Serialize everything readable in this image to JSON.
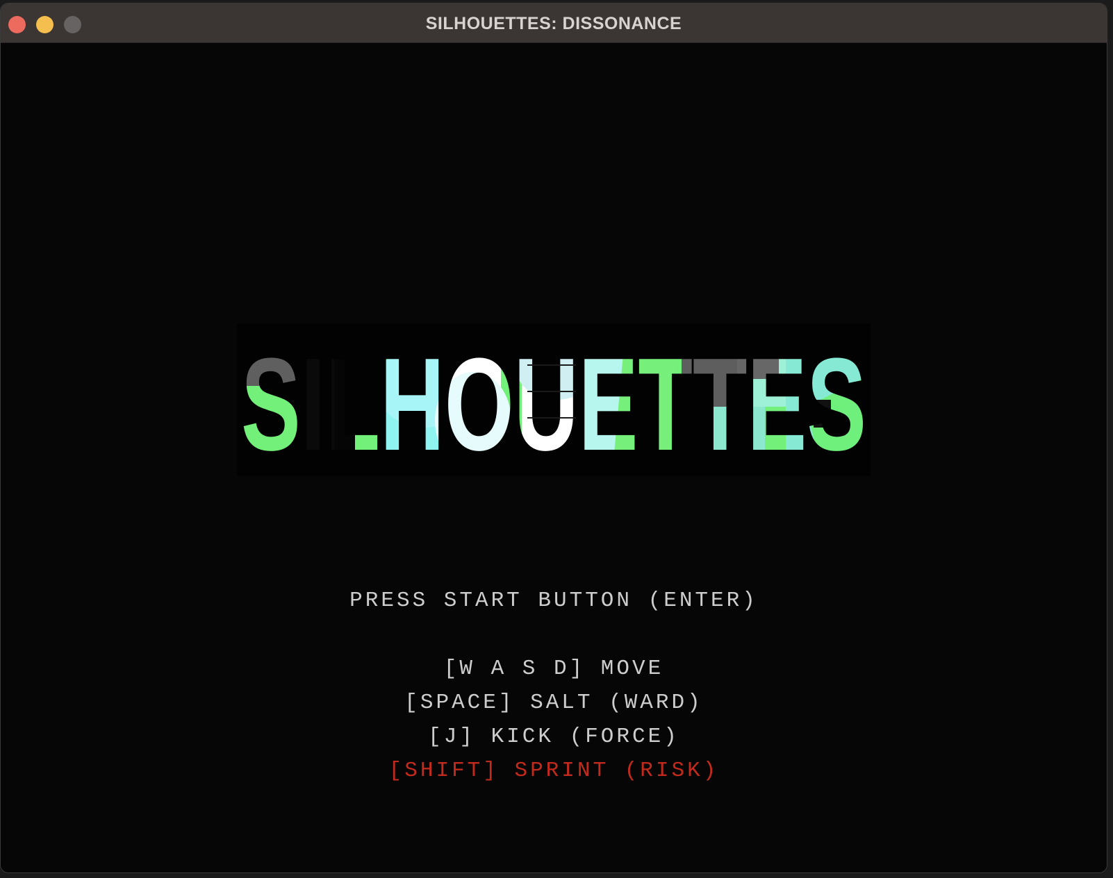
{
  "window": {
    "title": "SILHOUETTES: DISSONANCE",
    "controls": [
      "close",
      "minimize",
      "maximize"
    ]
  },
  "logo": {
    "text": "SILHOUETTES",
    "colors": {
      "green": "#73f07a",
      "cyan": "#8df0e8",
      "white": "#ffffff",
      "grey": "#5e5e5e"
    }
  },
  "menu": {
    "start_prompt": "PRESS START BUTTON (ENTER)",
    "controls": [
      "[W A S D] MOVE",
      "[SPACE] SALT (WARD)",
      "[J] KICK (FORCE)"
    ],
    "risk_control": "[SHIFT] SPRINT (RISK)",
    "risk_color": "#c22a1e"
  }
}
